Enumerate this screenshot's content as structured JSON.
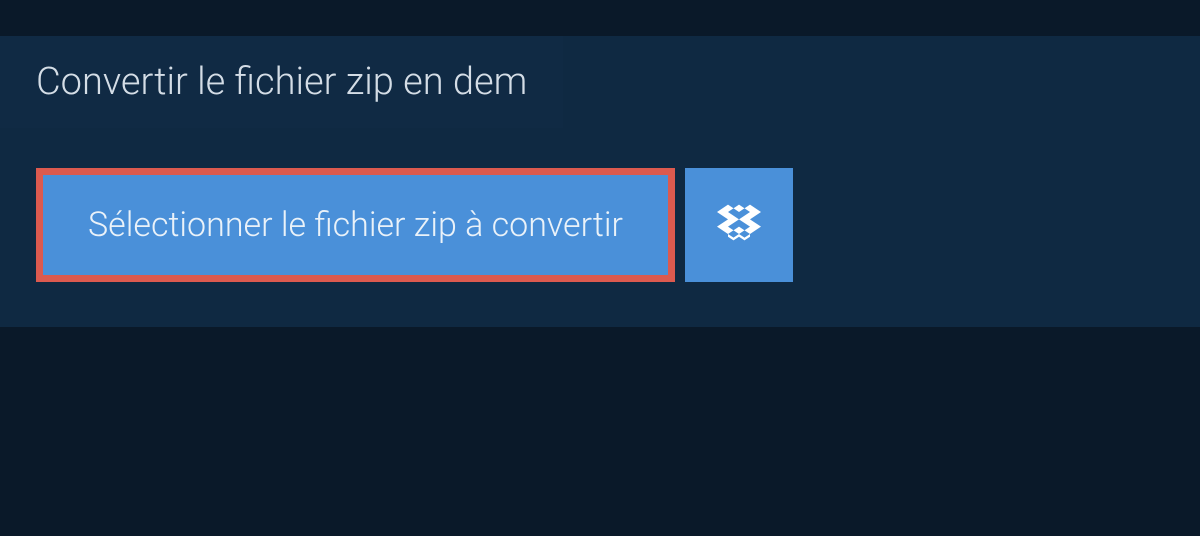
{
  "header": {
    "title": "Convertir le fichier zip en dem"
  },
  "actions": {
    "select_file_label": "Sélectionner le fichier zip à convertir"
  },
  "colors": {
    "background": "#0a1929",
    "panel": "#0f2942",
    "button": "#4a90d9",
    "highlight_border": "#dc5a4f",
    "text_light": "#d4dde6"
  }
}
